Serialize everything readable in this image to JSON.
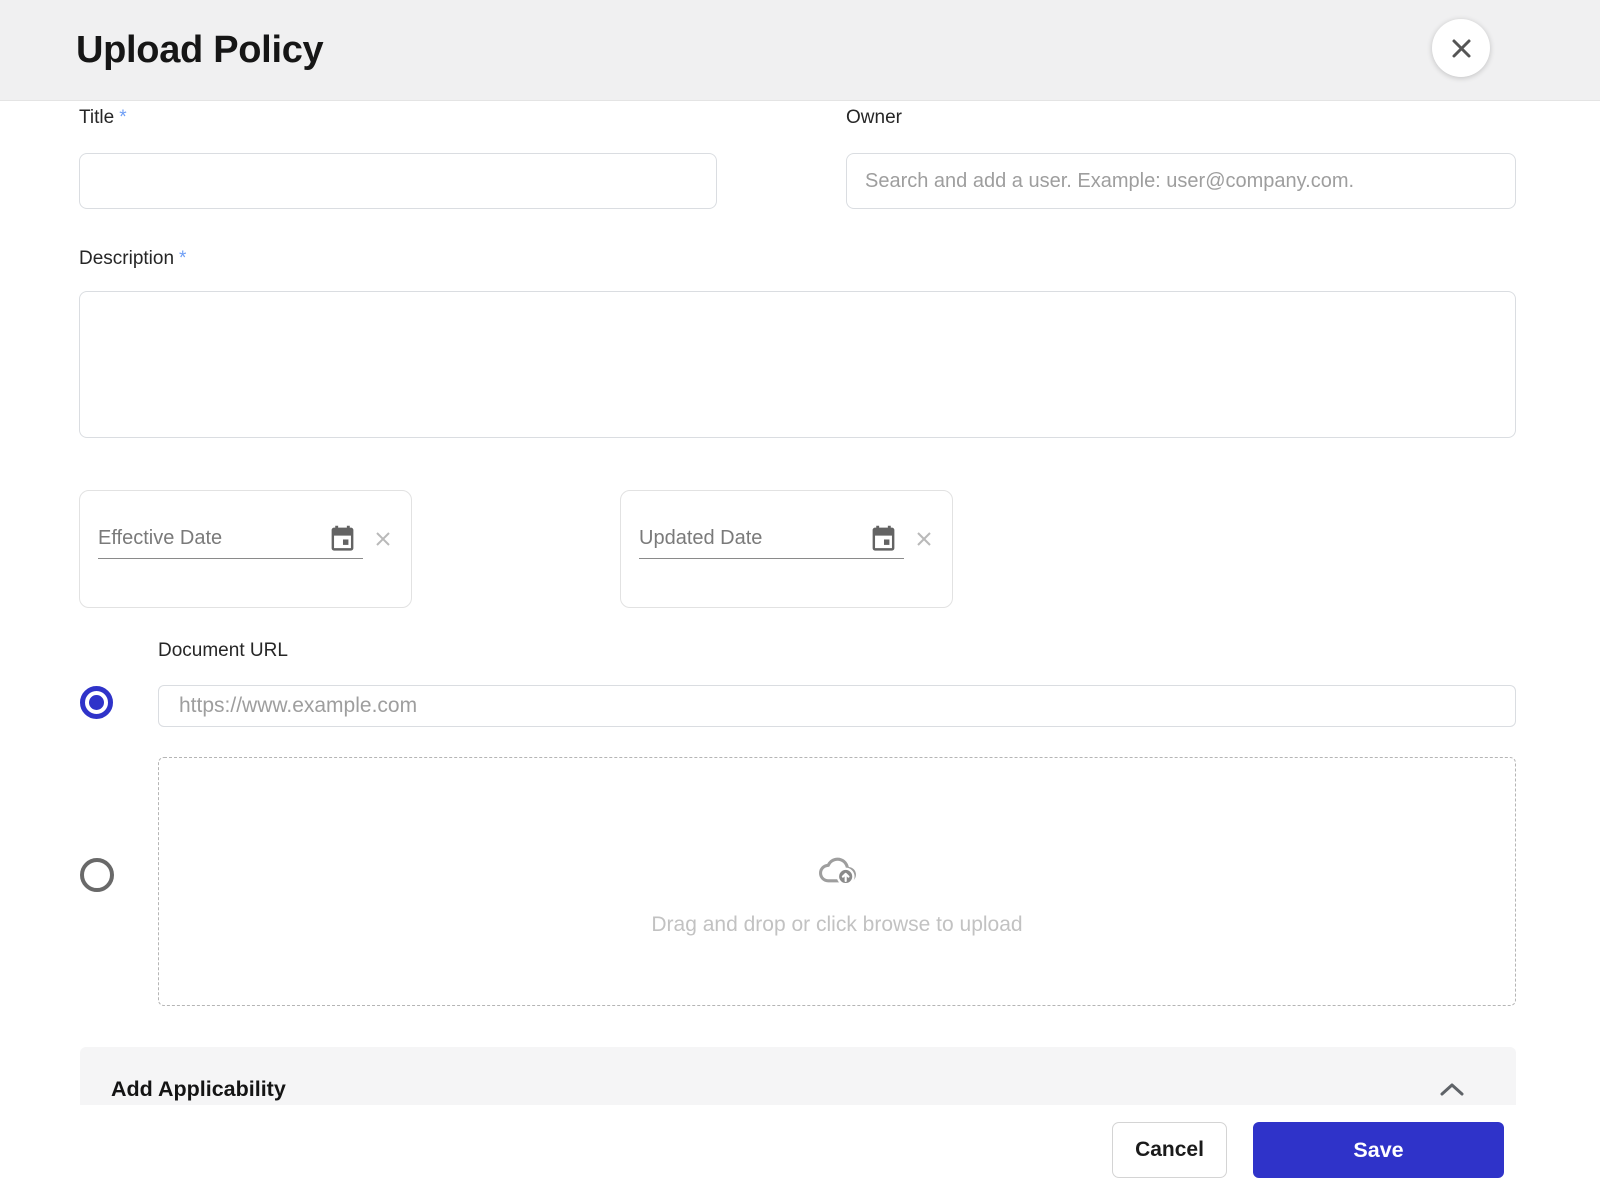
{
  "modal": {
    "title": "Upload Policy"
  },
  "form": {
    "title": {
      "label": "Title",
      "required_mark": "*",
      "value": ""
    },
    "owner": {
      "label": "Owner",
      "placeholder": "Search and add a user. Example: user@company.com.",
      "value": ""
    },
    "description": {
      "label": "Description",
      "required_mark": "*",
      "value": ""
    },
    "effective_date": {
      "placeholder": "Effective Date",
      "value": ""
    },
    "updated_date": {
      "placeholder": "Updated Date",
      "value": ""
    },
    "document_url": {
      "label": "Document URL",
      "placeholder": "https://www.example.com",
      "value": "",
      "radio_selected": true
    },
    "file_upload": {
      "hint": "Drag and drop or click browse to upload",
      "radio_selected": false
    }
  },
  "applicability": {
    "label": "Add Applicability",
    "expanded": true
  },
  "footer": {
    "cancel_label": "Cancel",
    "save_label": "Save"
  },
  "icons": {
    "close": "x-cross",
    "calendar": "calendar-event",
    "clear": "x-cross-light",
    "upload": "cloud-with-up-arrow",
    "collapse": "chevron-up"
  },
  "colors": {
    "accent_blue": "#2f33c9",
    "required_asterisk": "#6e9ef5",
    "header_bg": "#f0f0f1",
    "section_bg": "#f5f5f6",
    "placeholder_text": "#9e9e9e",
    "date_text": "#7a7a7a",
    "hint_text": "#c2c2c2"
  }
}
